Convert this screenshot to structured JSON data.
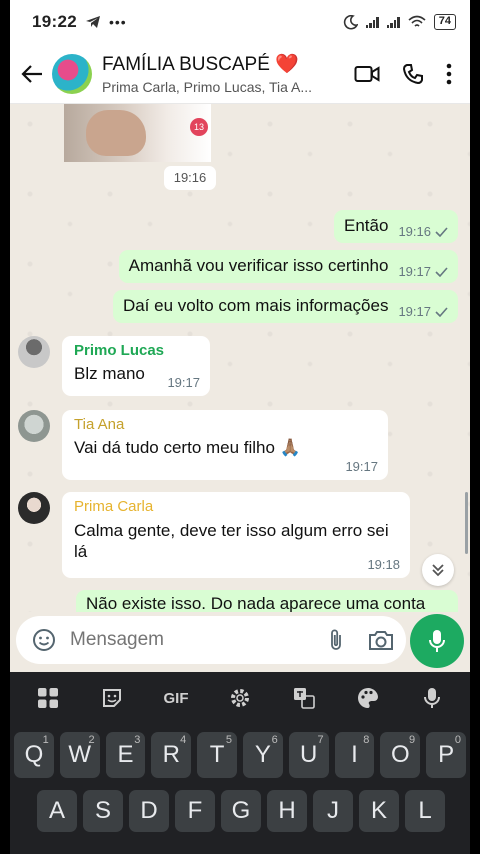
{
  "status": {
    "time": "19:22",
    "battery": "74"
  },
  "header": {
    "title": "FAMÍLIA BUSCAPÉ ❤️",
    "subtitle": "Prima Carla, Primo Lucas, Tia A..."
  },
  "chat": {
    "image_time": "19:16",
    "outgoing": [
      {
        "text": "Então",
        "time": "19:16"
      },
      {
        "text": "Amanhã vou verificar isso certinho",
        "time": "19:17"
      },
      {
        "text": "Daí eu volto com mais informações",
        "time": "19:17"
      }
    ],
    "incoming": [
      {
        "sender": "Primo Lucas",
        "text": "Blz mano",
        "time": "19:17",
        "color": "#1fa855"
      },
      {
        "sender": "Tia Ana",
        "text": "Vai dá tudo certo meu filho 🙏🏽",
        "time": "19:17",
        "color": "#c5a12c"
      },
      {
        "sender": "Prima Carla",
        "text": "Calma gente, deve ter isso algum erro sei lá",
        "time": "19:18",
        "color": "#e6b32f"
      }
    ],
    "partial_text": "Não existe isso. Do nada aparece uma conta"
  },
  "composer": {
    "placeholder": "Mensagem"
  },
  "keyboard": {
    "toolbar": [
      "apps-icon",
      "sticker-icon",
      "GIF",
      "settings-icon",
      "translate-icon",
      "palette-icon",
      "mic-icon"
    ],
    "row1": [
      {
        "k": "Q",
        "h": "1"
      },
      {
        "k": "W",
        "h": "2"
      },
      {
        "k": "E",
        "h": "3"
      },
      {
        "k": "R",
        "h": "4"
      },
      {
        "k": "T",
        "h": "5"
      },
      {
        "k": "Y",
        "h": "6"
      },
      {
        "k": "U",
        "h": "7"
      },
      {
        "k": "I",
        "h": "8"
      },
      {
        "k": "O",
        "h": "9"
      },
      {
        "k": "P",
        "h": "0"
      }
    ],
    "row2": [
      "A",
      "S",
      "D",
      "F",
      "G",
      "H",
      "J",
      "K",
      "L"
    ]
  },
  "colors": {
    "accent": "#1daa61",
    "outgoing_bubble": "#d9fdd3",
    "chat_bg": "#efeae2"
  }
}
